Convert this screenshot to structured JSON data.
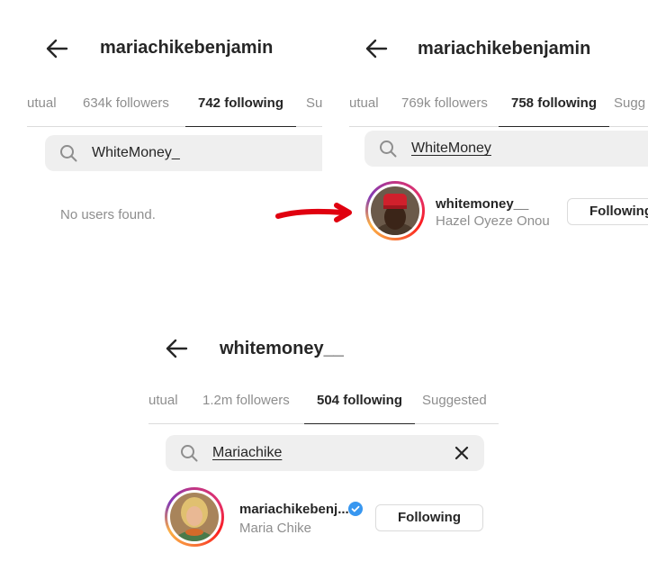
{
  "panel_a": {
    "username": "mariachikebenjamin",
    "tabs": [
      "utual",
      "634k followers",
      "742 following",
      "Su"
    ],
    "search_value": "WhiteMoney_",
    "empty_message": "No users found."
  },
  "panel_b": {
    "username": "mariachikebenjamin",
    "tabs": [
      "utual",
      "769k followers",
      "758 following",
      "Sugg"
    ],
    "search_value": "WhiteMoney",
    "result": {
      "handle": "whitemoney__",
      "full_name": "Hazel Oyeze Onou",
      "button": "Following"
    }
  },
  "panel_c": {
    "username": "whitemoney__",
    "tabs": [
      "utual",
      "1.2m followers",
      "504 following",
      "Suggested"
    ],
    "search_value": "Mariachike",
    "result": {
      "handle": "mariachikebenj...",
      "full_name": "Maria Chike",
      "button": "Following",
      "verified": true
    }
  },
  "icons": {
    "back": "arrow-left-icon",
    "search": "search-icon",
    "clear": "close-icon",
    "verified": "verified-badge-icon"
  },
  "colors": {
    "annotation_arrow": "#e0000f",
    "verified_blue": "#3897f0",
    "muted_text": "#8e8e8e"
  }
}
